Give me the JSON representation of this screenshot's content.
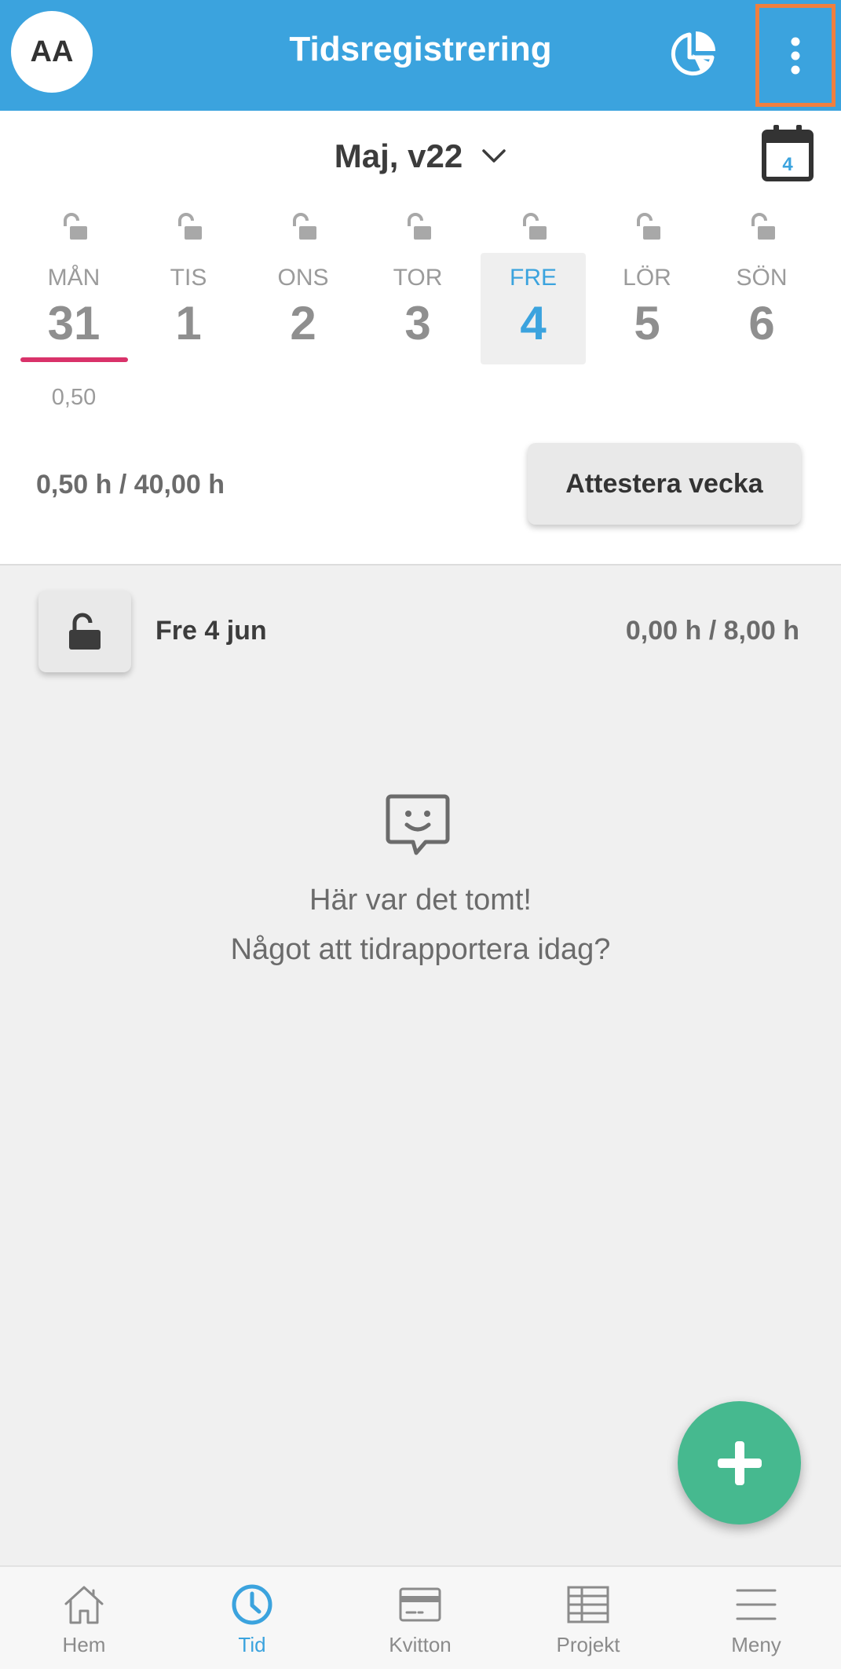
{
  "appbar": {
    "avatar_initials": "AA",
    "title": "Tidsregistrering",
    "chart_icon": "pie-chart-icon",
    "more_icon": "more-vertical-icon",
    "highlight_color": "#f07f3e"
  },
  "week": {
    "label": "Maj, v22",
    "calendar_day": "4",
    "days": [
      {
        "name": "MÅN",
        "num": "31",
        "hours": "0,50"
      },
      {
        "name": "TIS",
        "num": "1"
      },
      {
        "name": "ONS",
        "num": "2"
      },
      {
        "name": "TOR",
        "num": "3"
      },
      {
        "name": "FRE",
        "num": "4"
      },
      {
        "name": "LÖR",
        "num": "5"
      },
      {
        "name": "SÖN",
        "num": "6"
      }
    ],
    "total": "0,50 h / 40,00 h",
    "attest_label": "Attestera vecka"
  },
  "day": {
    "date": "Fre 4 jun",
    "total": "0,00 h / 8,00 h"
  },
  "empty": {
    "line1": "Här var det tomt!",
    "line2": "Något att tidrapportera idag?"
  },
  "nav": {
    "items": [
      {
        "label": "Hem",
        "icon": "home-icon"
      },
      {
        "label": "Tid",
        "icon": "clock-icon"
      },
      {
        "label": "Kvitton",
        "icon": "credit-card-icon"
      },
      {
        "label": "Projekt",
        "icon": "table-icon"
      },
      {
        "label": "Meny",
        "icon": "menu-icon"
      }
    ]
  },
  "colors": {
    "primary": "#3ba3de",
    "accent": "#46b98f",
    "today_marker": "#d9326a"
  }
}
